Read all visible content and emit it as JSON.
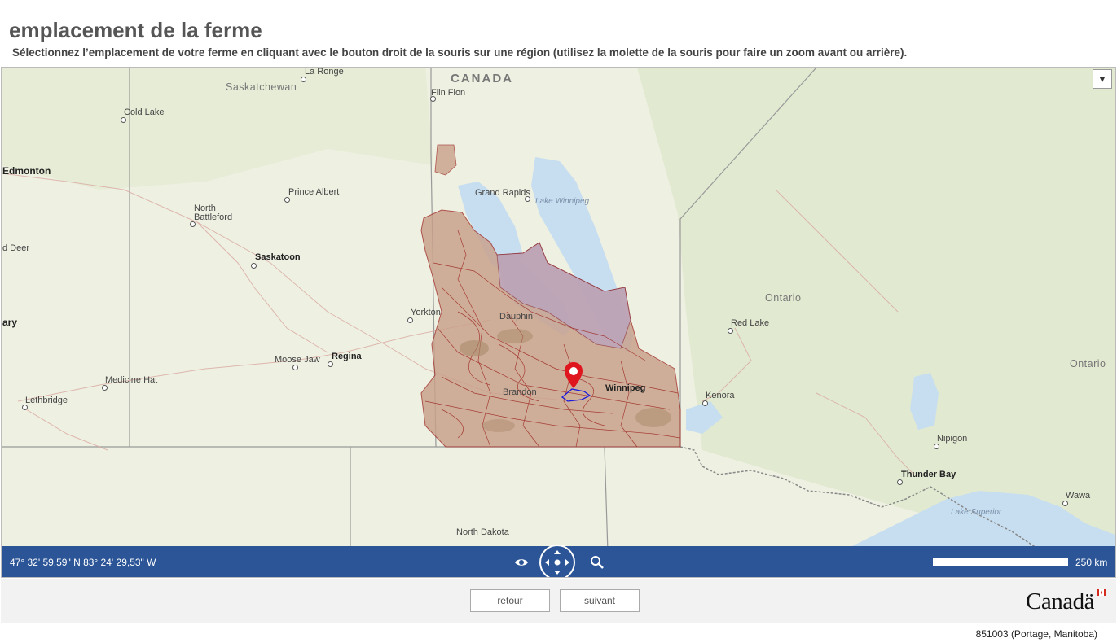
{
  "page": {
    "title": "emplacement de la ferme",
    "instructions": "Sélectionnez l’emplacement de votre ferme en cliquant avec le bouton droit de la souris sur une région (utilisez la molette de la souris pour faire un zoom avant ou arrière)."
  },
  "map": {
    "labels": {
      "canada": "CANADA",
      "saskatchewan": "Saskatchewan",
      "ontario1": "Ontario",
      "ontario2": "Ontario",
      "north_dakota": "North Dakota",
      "lake_winnipeg": "Lake Winnipeg",
      "lake_superior": "Lake Superior",
      "la_ronge": "La Ronge",
      "flin_flon": "Flin Flon",
      "cold_lake": "Cold Lake",
      "edmonton": "Edmonton",
      "prince_albert": "Prince Albert",
      "grand_rapids": "Grand Rapids",
      "north_battleford_1": "North",
      "north_battleford_2": "Battleford",
      "red_deer": "d Deer",
      "saskatoon": "Saskatoon",
      "yorkton": "Yorkton",
      "dauphin": "Dauphin",
      "calgary": "ary",
      "red_lake": "Red Lake",
      "moose_jaw": "Moose Jaw",
      "regina": "Regina",
      "medicine_hat": "Medicine Hat",
      "brandon": "Brandon",
      "winnipeg": "Winnipeg",
      "kenora": "Kenora",
      "lethbridge": "Lethbridge",
      "nipigon": "Nipigon",
      "thunder_bay": "Thunder Bay",
      "wawa": "Wawa"
    },
    "layer_toggle_icon": "▼",
    "marker_icon": "location-pin"
  },
  "toolbar": {
    "coordinates": "47° 32' 59,59\" N 83° 24' 29,53\" W",
    "eye_icon": "eye-icon",
    "pan_icon": "pan-arrows-icon",
    "zoom_icon": "magnifier-icon",
    "scale_label": "250 km"
  },
  "nav": {
    "back_label": "retour",
    "next_label": "suivant",
    "wordmark": "Canadä"
  },
  "footer": {
    "selection": "851003 (Portage, Manitoba)"
  },
  "colors": {
    "toolbar_bg": "#2b5597",
    "land": "#eef0e2",
    "water": "#c7def0",
    "soil_fill": "#c9a08a",
    "soil_outline": "#a0302a",
    "marker": "#e0161f"
  }
}
